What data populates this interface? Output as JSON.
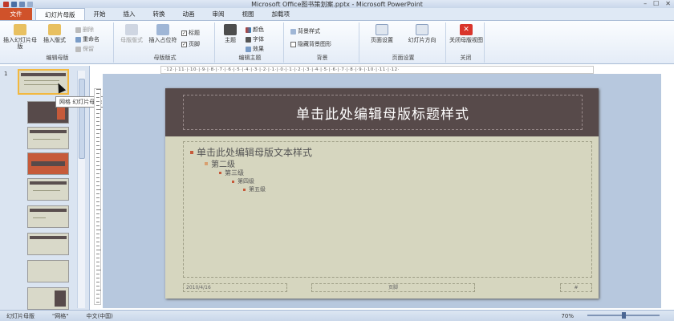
{
  "window": {
    "title": "Microsoft Office图书策划案.pptx - Microsoft PowerPoint",
    "controls": [
      "–",
      "☐",
      "✕"
    ]
  },
  "colors": {
    "file_tab": "#d0522a",
    "slide_header": "#574a4a",
    "slide_body": "#d6d6bf",
    "bullet": "#c65a3a",
    "selection": "#f2b83f"
  },
  "tabs": [
    {
      "label": "文件"
    },
    {
      "label": "幻灯片母版"
    },
    {
      "label": "开始"
    },
    {
      "label": "插入"
    },
    {
      "label": "转换"
    },
    {
      "label": "动画"
    },
    {
      "label": "审阅"
    },
    {
      "label": "视图"
    },
    {
      "label": "加载项"
    }
  ],
  "ribbon": {
    "edit_master": {
      "label": "编辑母版",
      "insert_master": "插入幻灯片母版",
      "insert_layout": "插入版式",
      "delete": "删除",
      "rename": "重命名",
      "preserve": "保留"
    },
    "master_layout": {
      "label": "母版版式",
      "master_layout_btn": "母版版式",
      "insert_placeholder": "插入占位符",
      "title": "标题",
      "footer": "页脚",
      "check": "✓"
    },
    "edit_theme": {
      "label": "编辑主题",
      "theme": "主题",
      "colors": "颜色",
      "fonts": "字体",
      "effects": "效果"
    },
    "background": {
      "label": "背景",
      "bg_styles": "背景样式",
      "hide_bg": "隐藏背景图形"
    },
    "page_setup": {
      "label": "页面设置",
      "setup": "页面设置",
      "orientation": "幻灯片方向"
    },
    "close": {
      "label": "关闭",
      "close_master": "关闭母版视图"
    }
  },
  "ruler_text": "·12·|·11·|·10·|·9·|·8·|·7·|·6·|·5·|·4·|·3·|·2·|·1·|·0·|·1·|·2·|·3·|·4·|·5·|·6·|·7·|·8·|·9·|·10·|·11·|·12·",
  "thumbnail_pane": {
    "slide_number": "1",
    "tooltip": "网格 幻灯片母版: 由幻灯片 1-9 使用"
  },
  "slide": {
    "title": "单击此处编辑母版标题样式",
    "levels": [
      "单击此处编辑母版文本样式",
      "第二级",
      "第三级",
      "第四级",
      "第五级"
    ],
    "date": "2010/4/16",
    "footer": "页脚",
    "page_number": "#"
  },
  "statusbar": {
    "view": "幻灯片母版",
    "theme": "\"网格\"",
    "language": "中文(中国)",
    "zoom": "70%",
    "zoom_level": 0.5
  }
}
